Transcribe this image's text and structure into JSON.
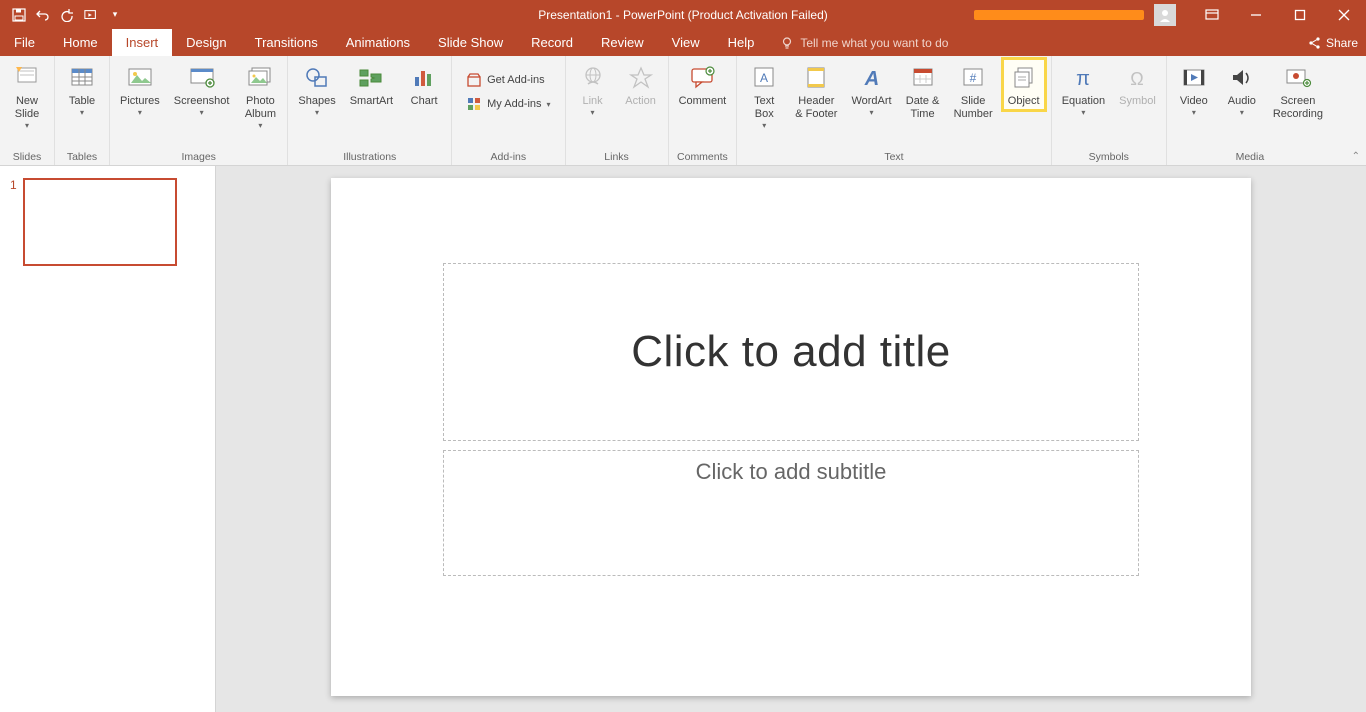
{
  "title_bar": {
    "doc_title": "Presentation1  -  PowerPoint (Product Activation Failed)"
  },
  "tabs": {
    "file": "File",
    "home": "Home",
    "insert": "Insert",
    "design": "Design",
    "transitions": "Transitions",
    "animations": "Animations",
    "slideshow": "Slide Show",
    "record": "Record",
    "review": "Review",
    "view": "View",
    "help": "Help",
    "tell_me": "Tell me what you want to do",
    "share": "Share"
  },
  "ribbon": {
    "groups": {
      "slides": {
        "label": "Slides",
        "new_slide": "New\nSlide"
      },
      "tables": {
        "label": "Tables",
        "table": "Table"
      },
      "images": {
        "label": "Images",
        "pictures": "Pictures",
        "screenshot": "Screenshot",
        "photo_album": "Photo\nAlbum"
      },
      "illustrations": {
        "label": "Illustrations",
        "shapes": "Shapes",
        "smartart": "SmartArt",
        "chart": "Chart"
      },
      "addins": {
        "label": "Add-ins",
        "get": "Get Add-ins",
        "my": "My Add-ins"
      },
      "links": {
        "label": "Links",
        "link": "Link",
        "action": "Action"
      },
      "comments": {
        "label": "Comments",
        "comment": "Comment"
      },
      "text": {
        "label": "Text",
        "textbox": "Text\nBox",
        "header": "Header\n& Footer",
        "wordart": "WordArt",
        "datetime": "Date &\nTime",
        "slidenum": "Slide\nNumber",
        "object": "Object"
      },
      "symbols": {
        "label": "Symbols",
        "equation": "Equation",
        "symbol": "Symbol"
      },
      "media": {
        "label": "Media",
        "video": "Video",
        "audio": "Audio",
        "screenrec": "Screen\nRecording"
      }
    }
  },
  "thumbs": {
    "num1": "1"
  },
  "slide": {
    "title_ph": "Click to add title",
    "subtitle_ph": "Click to add subtitle"
  }
}
